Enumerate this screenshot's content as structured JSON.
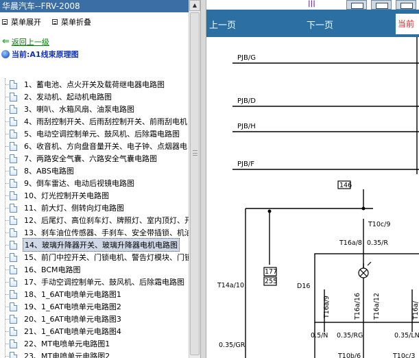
{
  "left_panel": {
    "title": "华晨汽车--FRV-2008",
    "expand_label": "菜单展开",
    "collapse_label": "菜单折叠",
    "back_link": "返回上一级",
    "current_label": "当前:A1线束原理图",
    "items": [
      "1、蓄电池、点火开关及载荷继电器电路图",
      "2、发动机、起动机电路图",
      "3、喇叭、水箱风扇、油泵电路图",
      "4、雨刮控制开关、后雨刮控制开关、前雨刮电机",
      "5、电动空调控制单元、鼓风机、后除霜电路图",
      "6、收音机、方向盘音量开关、电子钟、点烟器电",
      "7、两路安全气囊、六路安全气囊电路图",
      "8、ABS电路图",
      "9、倒车雷达、电动后视镜电路图",
      "10、灯光控制开关电路图",
      "11、前大灯、侧转向灯电路图",
      "12、后尾灯、高位刹车灯、牌照灯、室内顶灯、开",
      "13、刹车油位传感器、手刹车、安全带插锁、机油",
      "14、玻璃升降器开关、玻璃升降器电机电路图",
      "15、前门中控开关、门锁电机、警告灯模块、门锁",
      "16、BCM电路图",
      "17、手动空调控制单元、鼓风机、后除霜电路图",
      "18、1_6AT电喷单元电路图1",
      "19、1_6AT电喷单元电路图2",
      "20、1_6AT电喷单元电路图3",
      "21、1_6AT电喷单元电路图4",
      "22、MT电喷单元电路图1",
      "23、MT电喷单元电路图2"
    ],
    "selected_index": 13
  },
  "right_panel": {
    "prev_label": "上一页",
    "next_label": "下一页",
    "current_page_label": "当前"
  },
  "diagram": {
    "bus_labels": [
      "PJB/G",
      "PJB/D",
      "PJB/H",
      "PJB/F"
    ],
    "labels": {
      "conn_146": "146",
      "conn_177": "177",
      "conn_255": "255",
      "t10c9": "T10c/9",
      "t16a8": "T16a/8",
      "w035r": "0.35/R",
      "t14a10": "T14a/10",
      "d16": "D16",
      "t16a9": "T16a/9",
      "t16a16": "T16a/16",
      "t16a12": "T16a/12",
      "t16a": "T16a/",
      "w035gr": "0.35/GR",
      "w05n": "0.5/N",
      "w035rg": "0.35/RG",
      "w035ln": "0.35/LN",
      "t10b6": "T10b/6",
      "t10c3": "T10c/3"
    }
  }
}
